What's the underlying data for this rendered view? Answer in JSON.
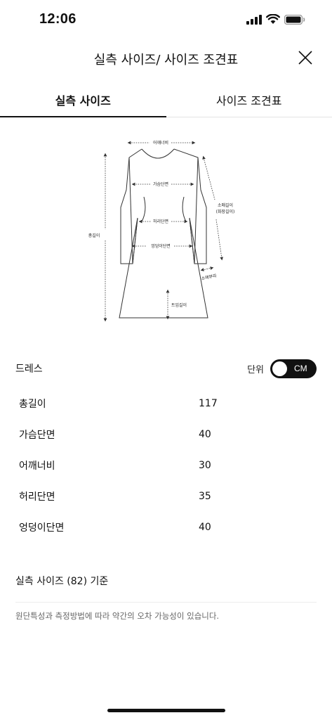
{
  "status_bar": {
    "time": "12:06"
  },
  "header": {
    "title": "실측 사이즈/ 사이즈 조견표"
  },
  "tabs": [
    {
      "label": "실측 사이즈",
      "active": true
    },
    {
      "label": "사이즈 조견표",
      "active": false
    }
  ],
  "diagram": {
    "shoulder": "어깨너비",
    "chest": "가슴단면",
    "waist": "허리단면",
    "hip": "엉덩이단면",
    "total_length": "총길이",
    "sleeve_length_1": "소매길이",
    "sleeve_length_2": "(화장길이)",
    "cuff": "소매부리",
    "slit": "트임길이"
  },
  "section": {
    "title": "드레스",
    "unit_label": "단위",
    "unit_value": "CM"
  },
  "sizes": [
    {
      "label": "총길이",
      "value": "117"
    },
    {
      "label": "가슴단면",
      "value": "40"
    },
    {
      "label": "어깨너비",
      "value": "30"
    },
    {
      "label": "허리단면",
      "value": "35"
    },
    {
      "label": "엉덩이단면",
      "value": "40"
    }
  ],
  "basis": "실측 사이즈 (82) 기준",
  "note": "원단특성과 측정방법에 따라 약간의 오차 가능성이 있습니다."
}
